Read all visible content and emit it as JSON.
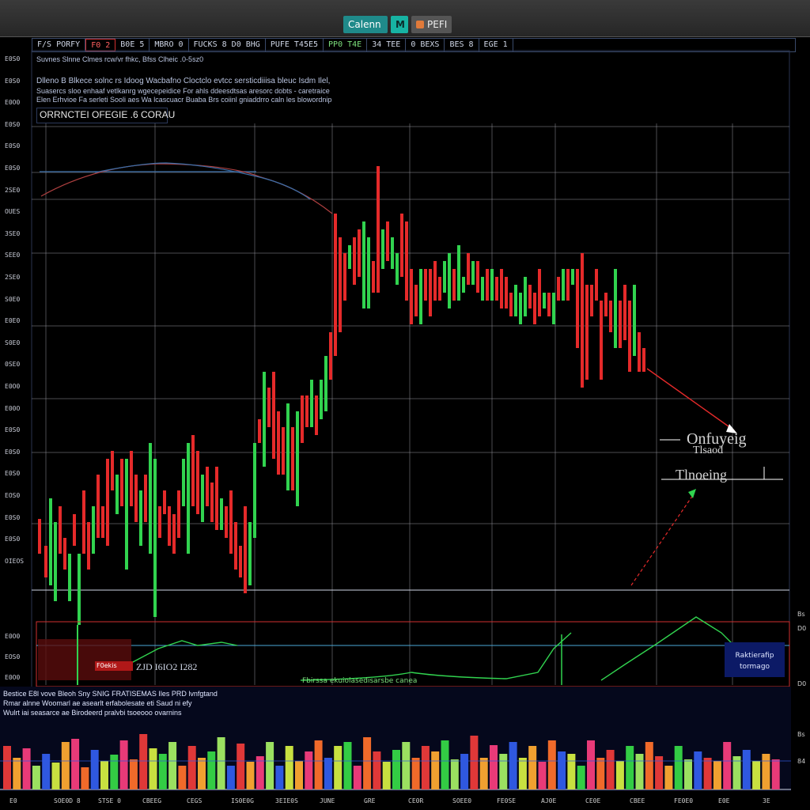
{
  "window": {
    "tabs": [
      {
        "label": "Calenn",
        "kind": "app"
      },
      {
        "label": "M",
        "kind": "m"
      },
      {
        "label": "PEFI",
        "kind": "p"
      }
    ]
  },
  "toolbar": {
    "cells": [
      {
        "text": "F/S PORFY",
        "style": "normal"
      },
      {
        "text": "F0  2",
        "style": "red"
      },
      {
        "text": "B0E  5",
        "style": "normal"
      },
      {
        "text": "MBRO  0",
        "style": "normal"
      },
      {
        "text": "FUCKS  8  D0  BHG",
        "style": "normal"
      },
      {
        "text": "PUFE  T45E5",
        "style": "normal"
      },
      {
        "text": "PP0  T4E",
        "style": "green"
      },
      {
        "text": "34  TEE",
        "style": "normal"
      },
      {
        "text": "0  BEXS",
        "style": "normal"
      },
      {
        "text": "BES  8",
        "style": "normal"
      },
      {
        "text": "EGE  1",
        "style": "normal"
      }
    ]
  },
  "info": {
    "title": "Suvnes  Slnne  Clmes  rcw/vr  fhkc,  Bfss  Clheic  .0-5sz0",
    "line1": "Dlleno  B  Blkece  solnc  rs  Idoog  Wacbafno  Cloctclo  evtcc  sersticdiiisa  bleuc  Isdm  Ilel,",
    "line2": "Suasercs  sloo  enhaaf  vetlkanrg  wgecepeidice  For  ahls  ddeesdtsas  aresorc  dobts  -  caretraice",
    "line3": "Elen  Erhvioe  Fa  serleti  Sooli  aes  Wa  lcascuacr  Buaba  Brs  coiinl  gniaddrro  caln  les  blowordnip",
    "instrument": "ORRNCTEI  OFEGIE  .6  CORAU"
  },
  "y_axis": [
    "E0S0",
    "E0S0",
    "E0O0",
    "E0S0",
    "E0S0",
    "E0S0",
    "2SE0",
    "OUES",
    "3SE0",
    "SEE0",
    "2SE0",
    "S0E0",
    "E0E0",
    "S0E0",
    "0SE0",
    "E0O0",
    "E00O",
    "E0S0",
    "E0S0",
    "E0S0",
    "EOS0",
    "E0S0",
    "E0S0",
    "OIEOS"
  ],
  "y_axis_sub": [
    "E0O0",
    "EOS0",
    "E0O0"
  ],
  "annotations": {
    "a1": "Onfuyeig",
    "a2": "Tlsaod",
    "a3": "Tlnoeing"
  },
  "subpanel": {
    "label": "ZJD  I6IO2  I282",
    "box_left": "F0ekis",
    "box_right_line1": "Raktierafip",
    "box_right_line2": "tormago",
    "info": "Fbirssa  ekuiolasedisarsbe  canea",
    "right_labels": [
      "Bs",
      "D0",
      "D0"
    ]
  },
  "volume": {
    "title": "Bestice  E8l  vove  Bleoh  Sny  SNIG  FRATISEMAS  Iles  PRD  lvnfgtand",
    "line1": "Rmar  alnne  Woomarl  ae  asearlt  erfabolesate  eti  Saud  ni  efy",
    "line2": "Wulrt  iai  seasarce  ae  Birodeerd  pralvbi  tsoeooo  ovarnins",
    "right_labels": [
      "Bs",
      "84"
    ]
  },
  "x_axis": [
    "E0",
    "SOE0D  8",
    "STSE  0",
    "CBEEG",
    "CEGS",
    "IS0E0G",
    "3EIE0S",
    "JUNE",
    "GRE",
    "CE0R",
    "SOEE0",
    "FE0SE",
    "AJ0E",
    "CE0E",
    "CBEE",
    "FE0E0",
    "E0E",
    "3E"
  ],
  "colors": {
    "bull": "#31d34f",
    "bear": "#e52a2a",
    "grid": "#8c8c94",
    "accent_blue": "#3a6ea8",
    "volume_palette": [
      "#e03838",
      "#33cc44",
      "#f06a2a",
      "#c8e040",
      "#e83a78",
      "#2f58e0",
      "#f0a030",
      "#9be060"
    ]
  }
}
